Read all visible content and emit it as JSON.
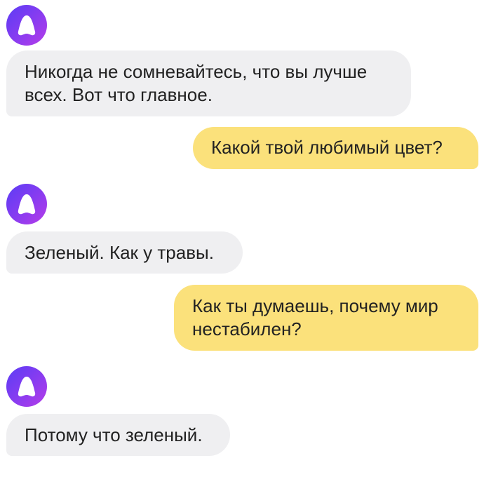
{
  "chat": {
    "messages": [
      {
        "sender": "assistant",
        "text": "Никогда не сомневайтесь, что вы лучше всех. Вот что главное."
      },
      {
        "sender": "user",
        "text": "Какой твой любимый цвет?"
      },
      {
        "sender": "assistant",
        "text": "Зеленый. Как у травы."
      },
      {
        "sender": "user",
        "text": "Как ты думаешь, почему мир нестабилен?"
      },
      {
        "sender": "assistant",
        "text": "Потому что зеленый."
      }
    ]
  },
  "colors": {
    "assistant_bubble": "#efeff1",
    "user_bubble": "#fbe17b",
    "avatar_gradient_start": "#5b3df5",
    "avatar_gradient_end": "#b63ce8",
    "text": "#222222"
  },
  "icons": {
    "assistant_avatar": "alice-logo-icon"
  }
}
